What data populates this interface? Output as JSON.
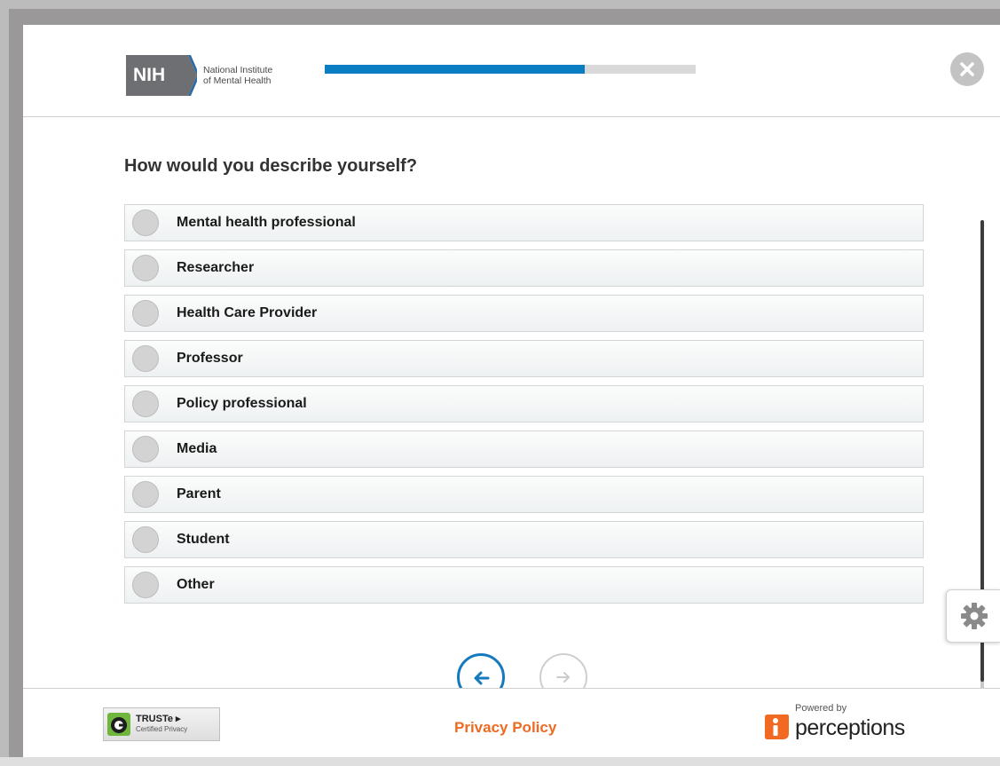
{
  "header": {
    "logo_abbr": "NIH",
    "logo_line1": "National Institute",
    "logo_line2": "of Mental Health",
    "progress_fraction": 0.7,
    "close_icon": "close-icon"
  },
  "survey": {
    "question": "How would you describe yourself?",
    "options": [
      "Mental health professional",
      "Researcher",
      "Health Care Provider",
      "Professor",
      "Policy professional",
      "Media",
      "Parent",
      "Student",
      "Other"
    ]
  },
  "nav": {
    "back_icon": "arrow-left-icon",
    "next_icon": "arrow-right-icon",
    "settings_icon": "gear-icon"
  },
  "footer": {
    "truste_title": "TRUSTe",
    "truste_sub": "Certified Privacy",
    "privacy_link": "Privacy Policy",
    "powered_by": "Powered by",
    "brand": "perceptions"
  },
  "colors": {
    "accent_blue": "#0b7dc2",
    "link_orange": "#ee6a22",
    "brand_orange": "#f26a21"
  }
}
